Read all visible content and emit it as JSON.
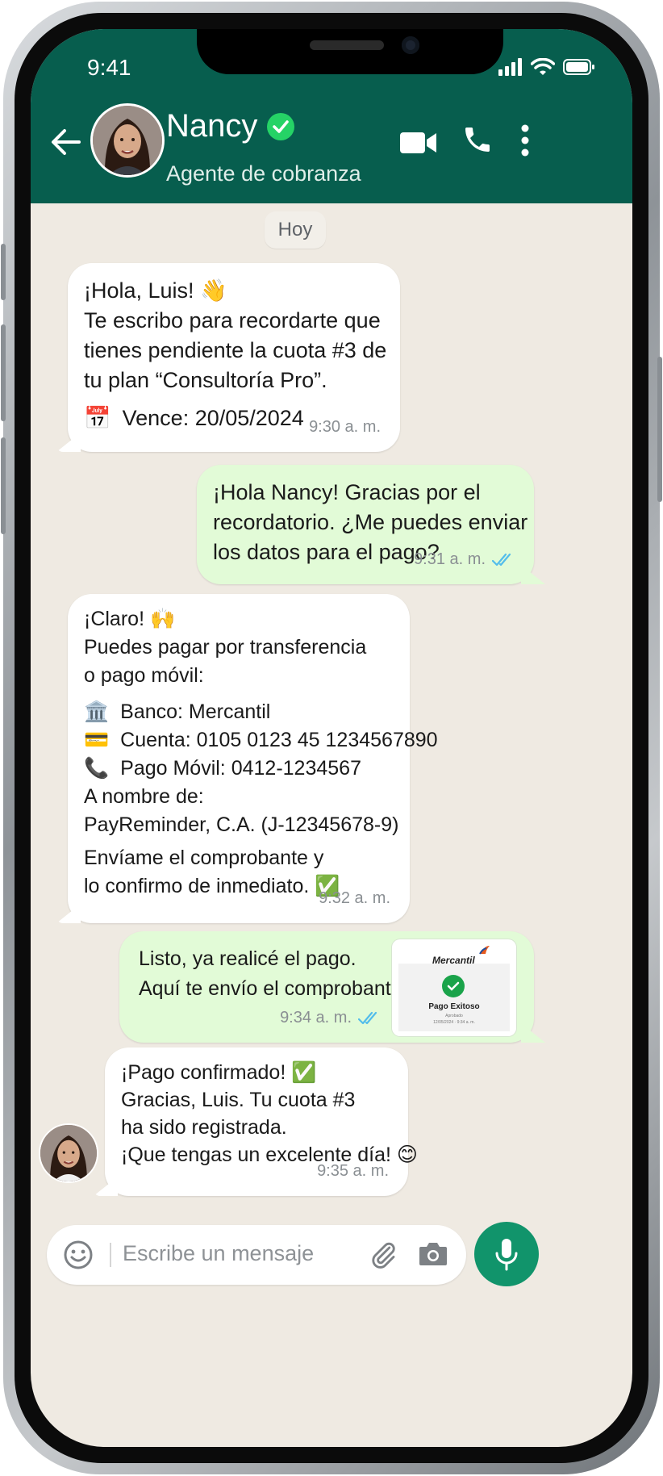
{
  "status_bar": {
    "time": "9:41"
  },
  "header": {
    "contact_name": "Nancy",
    "subtitle": "Agente de cobranza"
  },
  "chat": {
    "day_label": "Hoy",
    "messages": [
      {
        "from": "contact",
        "lines": [
          "¡Hola, Luis! 👋",
          "Te escribo para recordarte que",
          "tienes pendiente la cuota #3 de",
          "tu plan “Consultoría Pro”."
        ],
        "due_icon": "📅",
        "due_text": "Vence: 20/05/2024",
        "time": "9:30 a. m."
      },
      {
        "from": "me",
        "lines": [
          "¡Hola Nancy! Gracias por el",
          "recordatorio. ¿Me puedes enviar",
          "los datos para el pago?"
        ],
        "time": "9:31 a. m."
      },
      {
        "from": "contact",
        "lines": [
          "¡Claro! 🙌",
          "Puedes pagar por transferencia",
          "o pago móvil:"
        ],
        "details": [
          {
            "icon": "🏛️",
            "text": "Banco: Mercantil"
          },
          {
            "icon": "💳",
            "text": "Cuenta: 0105 0123 45 1234567890"
          },
          {
            "icon": "📞",
            "text": "Pago Móvil: 0412-1234567"
          }
        ],
        "holder_label": "A nombre de:",
        "holder": "PayReminder, C.A. (J-12345678-9)",
        "closing": [
          "Envíame el comprobante y",
          "lo confirmo de inmediato. ✅"
        ],
        "time": "9:32 a. m."
      },
      {
        "from": "me",
        "lines": [
          "Listo, ya realicé el pago.",
          "Aquí te envío el comprobante."
        ],
        "time": "9:34 a. m.",
        "attachment": {
          "bank": "Mercantil",
          "title": "Pago Exitoso",
          "small1": "Aprobado",
          "small2": "12/05/2024 · 9:34 a. m."
        }
      },
      {
        "from": "contact",
        "lines": [
          "¡Pago confirmado! ✅",
          "Gracias, Luis. Tu cuota #3",
          "ha sido registrada.",
          "¡Que tengas un excelente día! 😊"
        ],
        "time": "9:35 a. m."
      }
    ]
  },
  "composer": {
    "placeholder": "Escribe un mensaje"
  },
  "icons": [
    "back-arrow-icon",
    "verified-icon",
    "video-call-icon",
    "phone-call-icon",
    "more-options-icon",
    "emoji-icon",
    "attach-icon",
    "camera-icon",
    "mic-icon",
    "double-check-icon",
    "signal-icon",
    "wifi-icon",
    "battery-icon"
  ],
  "colors": {
    "header": "#075e4e",
    "outgoing": "#e2fbd7",
    "incoming": "#ffffff",
    "chat_bg": "#efeae2",
    "accent": "#11946b",
    "read_check": "#53bdeb"
  }
}
